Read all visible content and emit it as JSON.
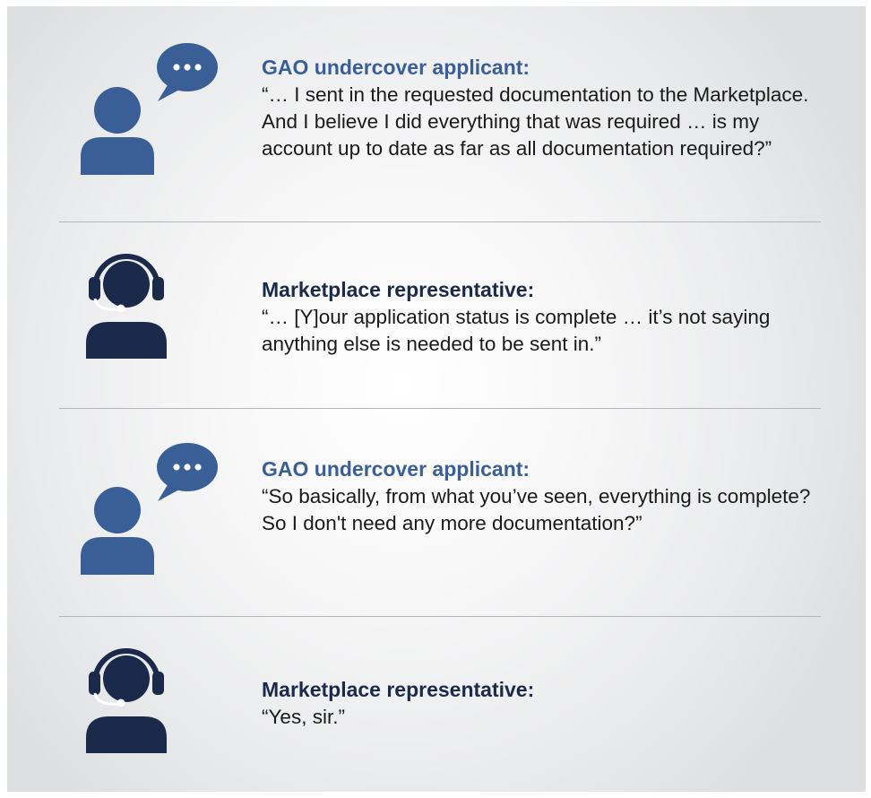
{
  "colors": {
    "applicant": "#3a5f96",
    "representative": "#1b2a4a",
    "divider": "#b3b5b8"
  },
  "exchanges": [
    {
      "speaker": "GAO undercover applicant:",
      "quote": "“… I sent in the requested documentation to the Marketplace. And I believe I did everything that was required … is my account up to date as far as all documentation required?”",
      "icon": "applicant-speech-bubble-icon"
    },
    {
      "speaker": "Marketplace representative:",
      "quote": "“… [Y]our application status is complete … it’s not saying anything else is needed to be sent in.”",
      "icon": "representative-headset-icon"
    },
    {
      "speaker": "GAO undercover applicant:",
      "quote": "“So basically, from what you’ve seen, everything is complete? So I don't need any more documentation?”",
      "icon": "applicant-speech-bubble-icon"
    },
    {
      "speaker": "Marketplace representative:",
      "quote": "“Yes, sir.”",
      "icon": "representative-headset-icon"
    }
  ]
}
